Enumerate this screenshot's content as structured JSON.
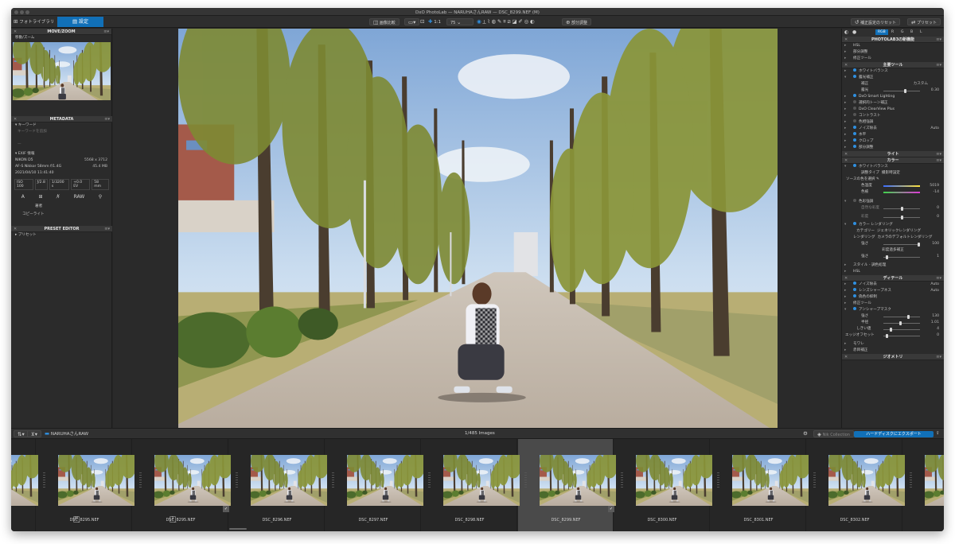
{
  "window": {
    "title": "DxO PhotoLab — NARUHAさんRAW — DSC_8299.NEF (M)"
  },
  "toolbar": {
    "photo_library_tab": "フォトライブラリ",
    "settings_tab": "設定",
    "compare_label": "画像比較",
    "zoom_ratio": "1:1",
    "zoom_level": "75",
    "local_adjust_label": "部分調整",
    "reset_label": "補正設定のリセット",
    "preset_label": "プリセット"
  },
  "left_panel": {
    "move_zoom": {
      "title": "MOVE/ZOOM",
      "subtitle": "移動/ズーム"
    },
    "metadata": {
      "title": "METADATA",
      "keyword_header": "キーワード",
      "keyword_placeholder": "キーワードを追加",
      "keyword_empty": "—",
      "exif_header": "EXIF 情報",
      "camera": "NIKON D5",
      "dimensions": "5568 x 3712",
      "lens": "AF-S Nikkor 58mm f/1.4G",
      "filesize": "45.4 MB",
      "datetime": "2021/04/10 11:41:40",
      "iso": "ISO 100",
      "aperture": "ƒ/2.8",
      "shutter": "1/3200 s",
      "ev": "+0.0 EV",
      "focal": "58 mm",
      "format": "RAW",
      "author_label": "著者",
      "copyright_label": "コピーライト"
    },
    "preset_editor": {
      "title": "PRESET EDITOR",
      "preset_row": "プリセット"
    }
  },
  "right_panel": {
    "tabs": [
      "RGB",
      "R",
      "G",
      "B",
      "L"
    ],
    "section_new": "PHOTOLAB3の新機能",
    "new_items": [
      "HSL",
      "部分調整",
      "修正ツール"
    ],
    "section_main": "主要ツール",
    "main_items": [
      {
        "label": "ホワイトバランス",
        "value": ""
      },
      {
        "label": "露光補正",
        "value": ""
      },
      {
        "label": "補正",
        "value": "カスタム"
      },
      {
        "label": "露光",
        "value": "0.30"
      },
      {
        "label": "DxO Smart Lighting",
        "value": ""
      },
      {
        "label": "選択的トーン補正",
        "value": ""
      },
      {
        "label": "DxO ClearView Plus",
        "value": ""
      },
      {
        "label": "コントラスト",
        "value": ""
      },
      {
        "label": "色相強調",
        "value": ""
      },
      {
        "label": "ノイズ除去",
        "value": "Auto"
      },
      {
        "label": "水平",
        "value": ""
      },
      {
        "label": "クロップ",
        "value": ""
      },
      {
        "label": "部分調整",
        "value": ""
      }
    ],
    "section_light": "ライト",
    "section_color": "カラー",
    "color_items": {
      "wb": "ホワイトバランス",
      "wb_type_label": "調整タイプ",
      "wb_type_value": "撮影時設定",
      "picker_label": "ソースの色を選択",
      "temp_label": "色温度",
      "temp_value": "5019",
      "tint_label": "色被",
      "tint_value": "-14",
      "vibrancy": "色彩強調",
      "vib1_label": "自然な彩度",
      "vib1_value": "0",
      "vib2_label": "彩度",
      "vib2_value": "0",
      "render": "カラー レンダリング",
      "cat_label": "カテゴリー",
      "cat_value": "ジェネリックレンダリング",
      "rend_label": "レンダリング",
      "rend_value": "カメラのデフォルトレンダリング",
      "strength_label": "強さ",
      "strength_value": "100",
      "protect_label": "彩度過多補正",
      "protect_strength_label": "強さ",
      "protect_value": "1",
      "style": "スタイル - 調色処理",
      "hsl": "HSL"
    },
    "section_detail": "ディテール",
    "detail_items": [
      {
        "label": "ノイズ除去",
        "value": "Auto"
      },
      {
        "label": "レンズシャープネス",
        "value": "Auto"
      },
      {
        "label": "偽色の抑制",
        "value": ""
      },
      {
        "label": "修正ツール",
        "value": ""
      },
      {
        "label": "アンシャープマスク",
        "value": ""
      }
    ],
    "unsharp": [
      {
        "label": "強さ",
        "value": "130"
      },
      {
        "label": "半径",
        "value": "1.01"
      },
      {
        "label": "しきい値",
        "value": "4"
      },
      {
        "label": "エッジオフセット",
        "value": "0"
      }
    ],
    "after_detail": [
      "モワレ",
      "赤目補正"
    ],
    "section_geometry": "ジオメトリ"
  },
  "filmstrip_bar": {
    "folder": "NARUHAさんRAW",
    "count": "1/485 Images",
    "nik": "Nik Collection",
    "export": "ハードディスクにエクスポート"
  },
  "filmstrip": [
    {
      "name": "",
      "partial": true,
      "checked": false,
      "badge": "",
      "selected": false,
      "portrait": false
    },
    {
      "name": "DSC_8295.NEF",
      "checked": false,
      "badge": "M",
      "selected": false,
      "portrait": false
    },
    {
      "name": "DSC_8295.NEF",
      "checked": true,
      "badge": "1",
      "selected": false,
      "portrait": false
    },
    {
      "name": "DSC_8296.NEF",
      "checked": false,
      "badge": "",
      "selected": false,
      "portrait": false
    },
    {
      "name": "DSC_8297.NEF",
      "checked": false,
      "badge": "",
      "selected": false,
      "portrait": false
    },
    {
      "name": "DSC_8298.NEF",
      "checked": false,
      "badge": "",
      "selected": false,
      "portrait": false
    },
    {
      "name": "DSC_8299.NEF",
      "checked": true,
      "badge": "",
      "selected": true,
      "portrait": false
    },
    {
      "name": "DSC_8300.NEF",
      "checked": false,
      "badge": "",
      "selected": false,
      "portrait": true
    },
    {
      "name": "DSC_8301.NEF",
      "checked": false,
      "badge": "",
      "selected": false,
      "portrait": true
    },
    {
      "name": "DSC_8302.NEF",
      "checked": false,
      "badge": "",
      "selected": false,
      "portrait": true
    },
    {
      "name": "",
      "partial": true,
      "checked": false,
      "badge": "",
      "selected": false,
      "portrait": false
    }
  ],
  "colors": {
    "accent": "#1170b8",
    "panel": "#2b2b2b",
    "sky": "#a9c8e8",
    "foliage": "#8d9a3c"
  }
}
